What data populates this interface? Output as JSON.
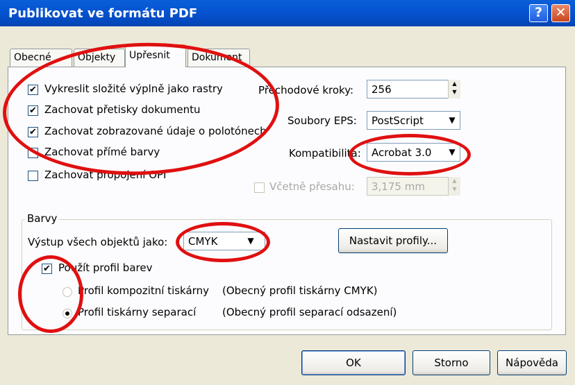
{
  "window": {
    "title": "Publikovat ve formátu PDF"
  },
  "titlebar": {
    "help_glyph": "?",
    "close_glyph": "✕"
  },
  "tabs": [
    {
      "label": "Obecné"
    },
    {
      "label": "Objekty"
    },
    {
      "label": "Upřesnit"
    },
    {
      "label": "Dokument"
    }
  ],
  "active_tab": "Upřesnit",
  "options": {
    "raster_fills": {
      "label": "Vykreslit složité výplně jako rastry",
      "checked": true
    },
    "overprints": {
      "label": "Zachovat přetisky dokumentu",
      "checked": true
    },
    "halftone": {
      "label": "Zachovat zobrazované údaje o polotónech",
      "checked": true
    },
    "spot_colors": {
      "label": "Zachovat přímé barvy",
      "checked": false
    },
    "opi_links": {
      "label": "Zachovat propojení OPI",
      "checked": false
    }
  },
  "transition_steps": {
    "label": "Přechodové kroky:",
    "value": "256"
  },
  "eps_files": {
    "label": "Soubory EPS:",
    "value": "PostScript"
  },
  "compatibility": {
    "label": "Kompatibilita:",
    "value": "Acrobat 3.0"
  },
  "bleed": {
    "label": "Včetně přesahu:",
    "value": "3,175 mm",
    "checked": false,
    "enabled": false
  },
  "colors": {
    "legend": "Barvy",
    "output_label": "Výstup všech objektů jako:",
    "output_value": "CMYK",
    "profiles_button": "Nastavit profily...",
    "use_profile": {
      "label": "Použít profil barev",
      "checked": true
    },
    "composite": {
      "label": "Profil kompozitní tiskárny",
      "profile": "(Obecný profil tiskárny CMYK)",
      "selected": false
    },
    "separation": {
      "label": "Profil tiskárny separací",
      "profile": "(Obecný profil separací odsazení)",
      "selected": true
    }
  },
  "buttons": {
    "ok": "OK",
    "cancel": "Storno",
    "help": "Nápověda"
  },
  "icons": {
    "check": "✔",
    "dropdown": "▼",
    "spin_up": "▲",
    "spin_down": "▼"
  },
  "accent_colors": {
    "titlebar": "#0553d1",
    "annotation": "#e01010"
  }
}
